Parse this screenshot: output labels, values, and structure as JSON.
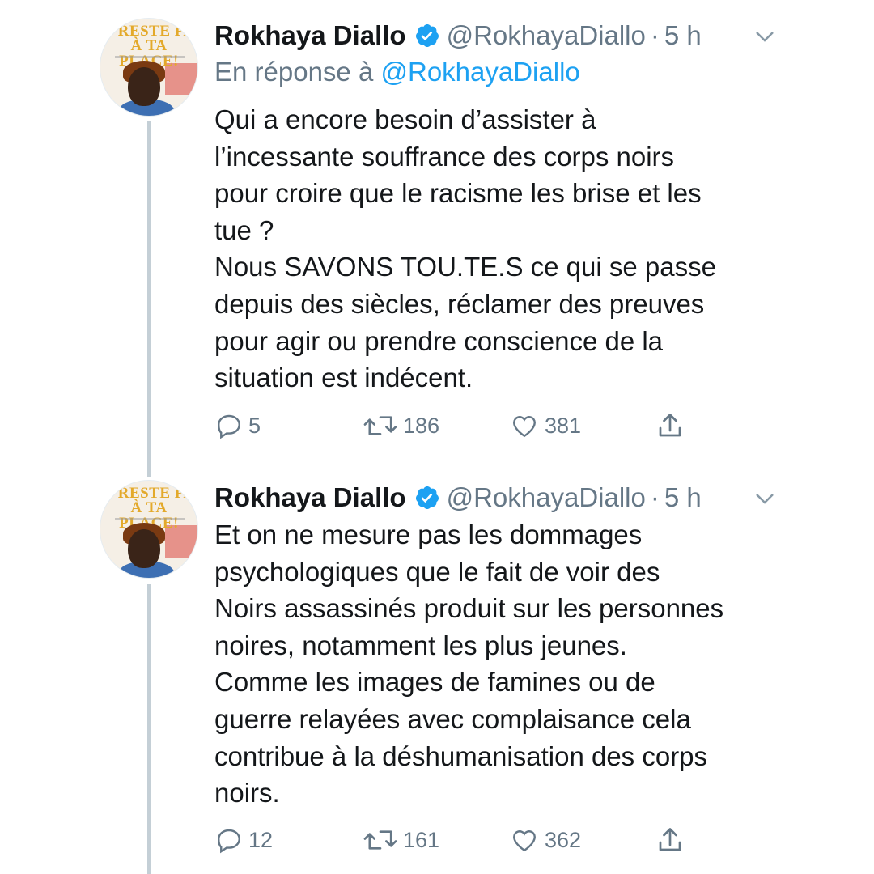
{
  "tweets": [
    {
      "author_name": "Rokhaya Diallo",
      "handle": "@RokhayaDiallo",
      "separator": "·",
      "time": "5 h",
      "reply_prefix": "En réponse à",
      "reply_mention": "@RokhayaDiallo",
      "avatar_text_line1": "E RESTE PA",
      "avatar_text_line2": "À TA PLACE!",
      "lines": [
        "Qui a encore besoin d’assister à",
        "l’incessante souffrance des corps noirs",
        "pour croire que le racisme les brise et les",
        "tue ?",
        "Nous SAVONS TOU.TE.S ce qui se passe",
        "depuis des siècles, réclamer des preuves",
        "pour agir ou prendre conscience de la",
        "situation est indécent."
      ],
      "replies": "5",
      "retweets": "186",
      "likes": "381"
    },
    {
      "author_name": "Rokhaya Diallo",
      "handle": "@RokhayaDiallo",
      "separator": "·",
      "time": "5 h",
      "avatar_text_line1": "E RESTE PA",
      "avatar_text_line2": "À TA PLACE!",
      "lines": [
        "Et on ne mesure pas les dommages",
        "psychologiques que le fait de voir des",
        "Noirs assassinés produit sur les personnes",
        "noires, notamment les plus jeunes.",
        "Comme les images de famines ou de",
        "guerre relayées avec complaisance cela",
        "contribue à la déshumanisation des corps",
        "noirs."
      ],
      "replies": "12",
      "retweets": "161",
      "likes": "362"
    }
  ],
  "icons": {
    "verified": "verified-badge-icon",
    "chevron": "chevron-down-icon",
    "reply": "reply-icon",
    "retweet": "retweet-icon",
    "like": "heart-icon",
    "share": "share-icon"
  },
  "colors": {
    "text": "#14171a",
    "secondary": "#657786",
    "accent": "#1da1f2",
    "thread_line": "#c4cfd6"
  }
}
